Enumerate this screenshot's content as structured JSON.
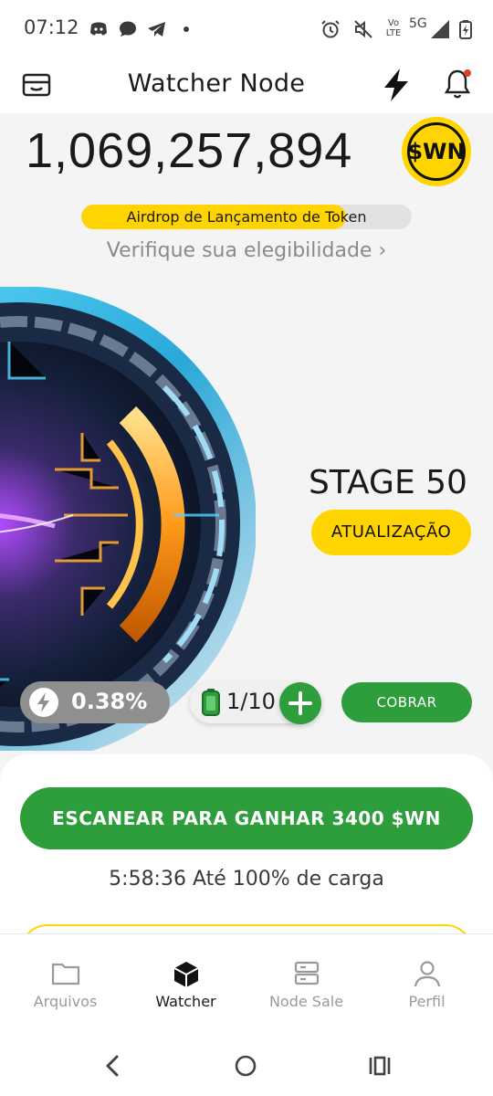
{
  "status_bar": {
    "time": "07:12",
    "network": "5G",
    "volte": "Vo LTE",
    "icons": [
      "discord-icon",
      "chat-bubble-icon",
      "telegram-icon",
      "dot-icon",
      "alarm-icon",
      "mute-icon",
      "signal-icon",
      "battery-charging-icon"
    ]
  },
  "header": {
    "title": "Watcher Node",
    "left_icon": "wallet-icon",
    "right_icons": [
      "lightning-icon",
      "bell-icon"
    ],
    "notification_dot_color": "#e53935"
  },
  "balance": {
    "amount": "1,069,257,894",
    "token_badge": "$WN"
  },
  "airdrop": {
    "label": "Airdrop de Lançamento de Token",
    "progress": 0.8,
    "verify_link": "Verifique sua elegibilidade ›"
  },
  "node": {
    "stage": "STAGE 50",
    "upgrade_label": "ATUALIZAÇÃO",
    "energy": "0.38%",
    "battery": "1/10",
    "collect_label": "COBRAR"
  },
  "scan": {
    "button_label": "ESCANEAR PARA GANHAR 3400 $WN",
    "charge_text": "5:58:36 Até 100% de carga"
  },
  "bottom_nav": {
    "items": [
      {
        "label": "Arquivos",
        "icon": "folder-icon",
        "active": false
      },
      {
        "label": "Watcher",
        "icon": "cube-icon",
        "active": true
      },
      {
        "label": "Node Sale",
        "icon": "server-icon",
        "active": false
      },
      {
        "label": "Perfil",
        "icon": "person-icon",
        "active": false
      }
    ]
  },
  "system_nav": [
    "back-icon",
    "home-icon",
    "recents-icon"
  ],
  "colors": {
    "accent_yellow": "#ffd400",
    "accent_green": "#2e9e3d",
    "background": "#f4f4f4"
  }
}
